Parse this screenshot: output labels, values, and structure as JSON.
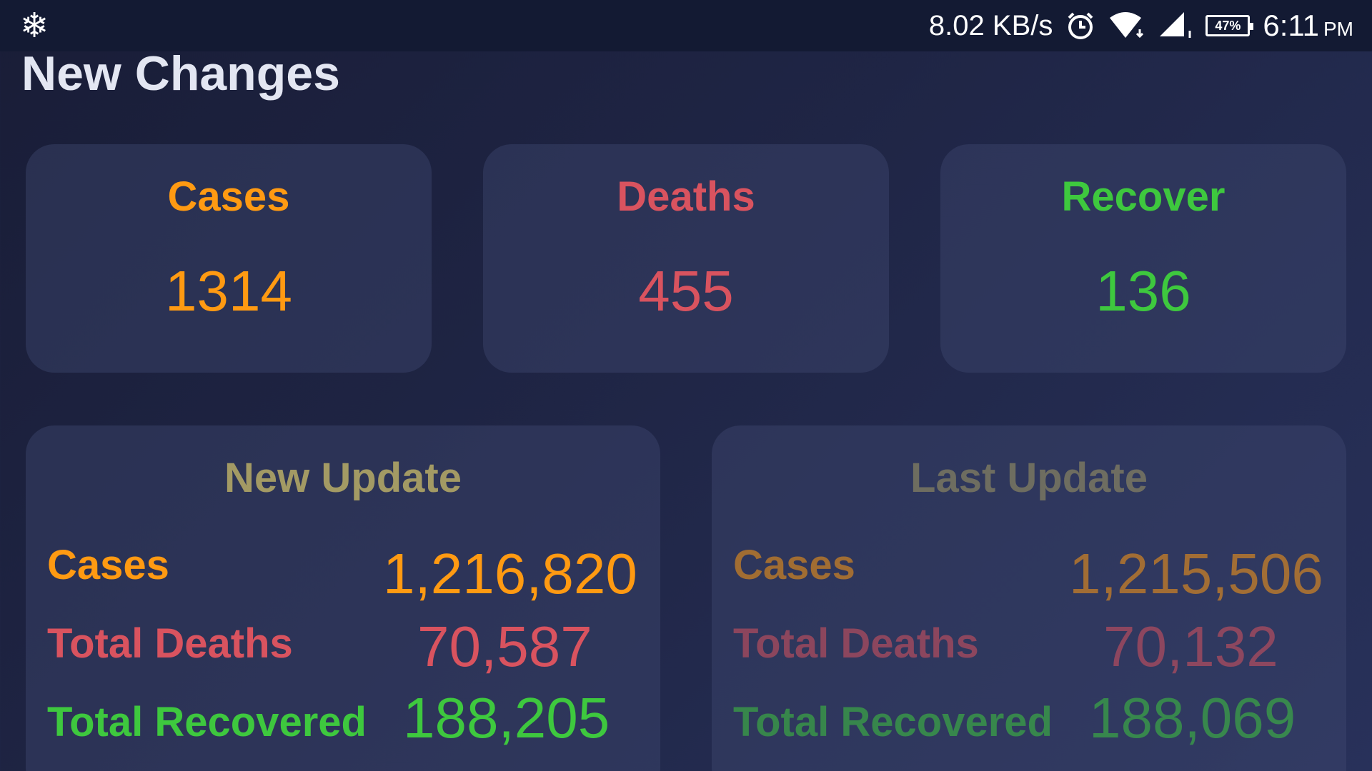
{
  "status_bar": {
    "speed": "8.02 KB/s",
    "battery": "47%",
    "time": "6:11",
    "ampm": "PM"
  },
  "page": {
    "title": "New Changes"
  },
  "stats": [
    {
      "label": "Cases",
      "value": "1314",
      "color": "#ff9a12"
    },
    {
      "label": "Deaths",
      "value": "455",
      "color": "#d9535f"
    },
    {
      "label": "Recover",
      "value": "136",
      "color": "#3ec83e"
    }
  ],
  "new_update": {
    "title": "New Update",
    "cases_label": "Cases",
    "cases_value": "1,216,820",
    "deaths_label": "Total Deaths",
    "deaths_value": "70,587",
    "recovered_label": "Total Recovered",
    "recovered_value": "188,205"
  },
  "last_update": {
    "title": "Last Update",
    "cases_label": "Cases",
    "cases_value": "1,215,506",
    "deaths_label": "Total Deaths",
    "deaths_value": "70,132",
    "recovered_label": "Total Recovered",
    "recovered_value": "188,069"
  },
  "colors": {
    "title_olive": "#a39a64"
  }
}
